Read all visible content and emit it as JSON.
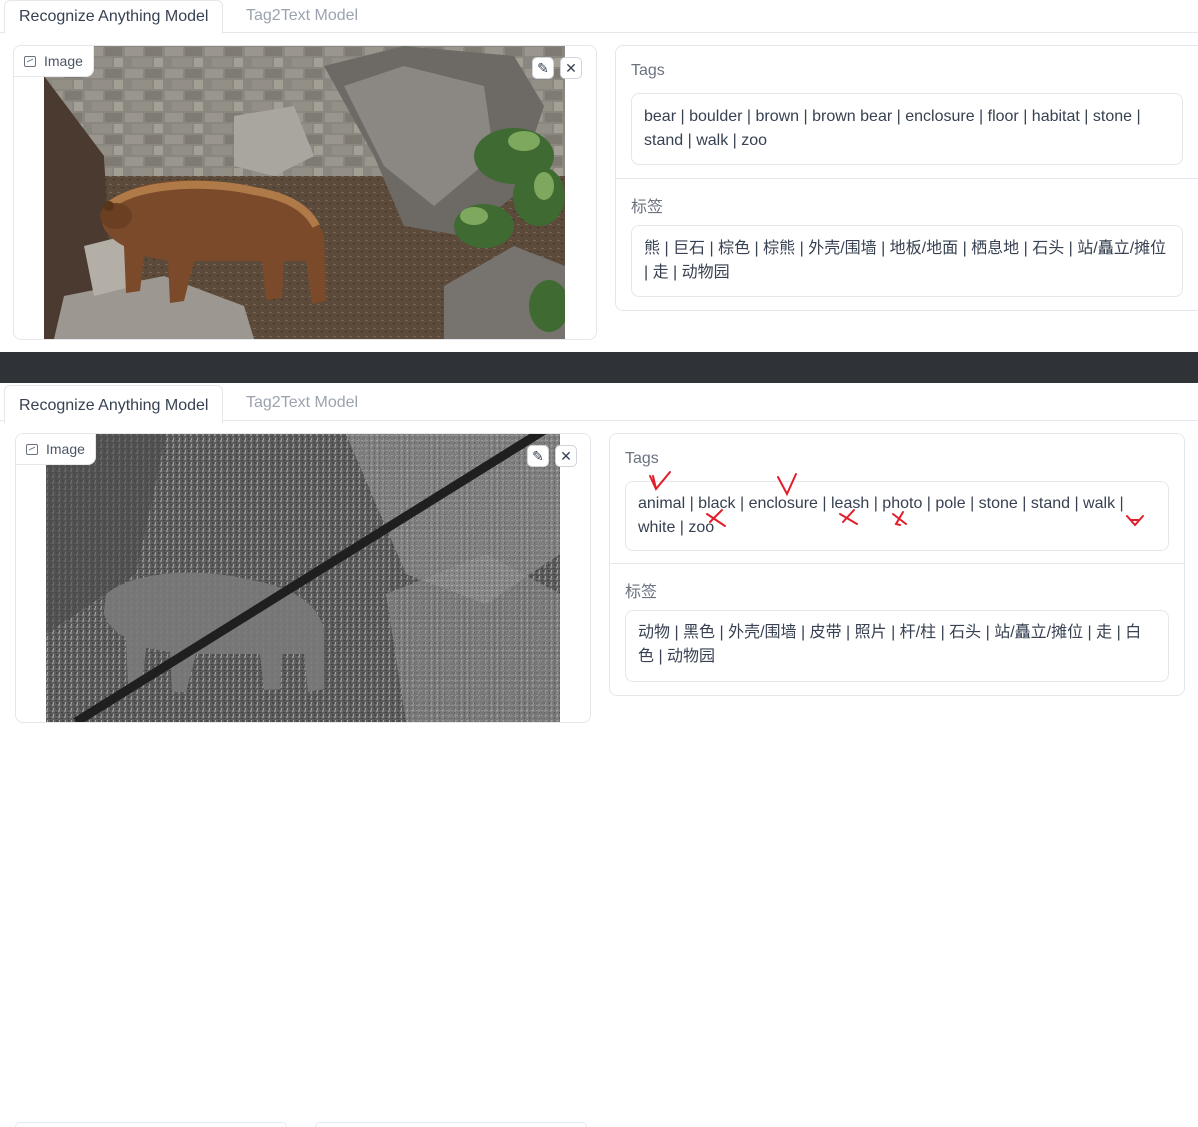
{
  "panel_top": {
    "tabs": [
      {
        "label": "Recognize Anything Model",
        "active": true
      },
      {
        "label": "Tag2Text Model",
        "active": false
      }
    ],
    "image_label": "Image",
    "image_icon": "image-icon",
    "edit_icon": "pencil-icon",
    "close_icon": "close-icon",
    "tags_label": "Tags",
    "tags_value": "bear | boulder | brown | brown bear | enclosure | floor | habitat | stone | stand | walk | zoo",
    "cn_label": "标签",
    "cn_value": "熊 | 巨石 | 棕色 | 棕熊 | 外壳/围墙 | 地板/地面 | 栖息地 | 石头 | 站/矗立/摊位 | 走 | 动物园"
  },
  "panel_bottom": {
    "tabs": [
      {
        "label": "Recognize Anything Model",
        "active": true
      },
      {
        "label": "Tag2Text Model",
        "active": false
      }
    ],
    "image_label": "Image",
    "image_icon": "image-icon",
    "edit_icon": "pencil-icon",
    "close_icon": "close-icon",
    "tags_label": "Tags",
    "tags_value": "animal | black | enclosure | leash | photo | pole | stone | stand | walk | white | zoo",
    "cn_label": "标签",
    "cn_value": "动物 | 黑色 | 外壳/围墙 | 皮带 | 照片 | 杆/柱 | 石头 | 站/矗立/摊位 | 走 | 白色 | 动物园",
    "annotations": {
      "correct_tags": [
        "animal",
        "enclosure"
      ],
      "incorrect_tags": [
        "black",
        "leash",
        "photo",
        "white"
      ],
      "mark_color": "#e11d2a"
    }
  },
  "colors": {
    "divider": "#2f3338",
    "border": "#e5e7eb",
    "text": "#374151",
    "muted": "#9ca3af"
  }
}
